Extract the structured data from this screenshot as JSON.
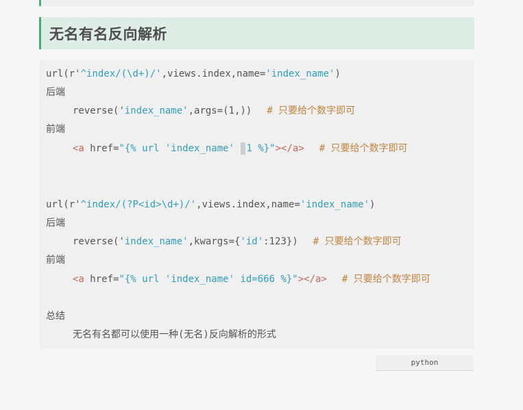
{
  "heading": "无名有名反向解析",
  "code": {
    "line1": {
      "a": "url",
      "b": "(r'",
      "c": "^index/(\\d+)/'",
      "d": ",views.index,name=",
      "e": "'index_name'",
      "f": ")"
    },
    "line2": "后端",
    "line3": {
      "a": "reverse",
      "b": "('",
      "c": "index_name'",
      "d": ",args=(1,))",
      "e": "# 只要给个数字即可"
    },
    "line4": "前端",
    "line5": {
      "a": "<a",
      "b": " href=",
      "c": "\"{% url 'index_name' ",
      "d": "1",
      "e": " %}\"",
      "f": "></a>",
      "g": "# 只要给个数字即可"
    },
    "line6": {
      "a": "url",
      "b": "(r'",
      "c": "^index/(?P<id>\\d+)/'",
      "d": ",views.index,name=",
      "e": "'index_name'",
      "f": ")"
    },
    "line7": "后端",
    "line8": {
      "a": "reverse",
      "b": "('",
      "c": "index_name'",
      "d": ",kwargs={",
      "e": "'id'",
      "f": ":123})",
      "g": "# 只要给个数字即可"
    },
    "line9": "前端",
    "line10": {
      "a": "<a",
      "b": " href=",
      "c": "\"{% url 'index_name' ",
      "d": "id=666 %}\"",
      "e": "></a>",
      "f": "# 只要给个数字即可"
    },
    "line11": "总结",
    "line12": "无名有名都可以使用一种(无名)反向解析的形式"
  },
  "language_label": "python"
}
